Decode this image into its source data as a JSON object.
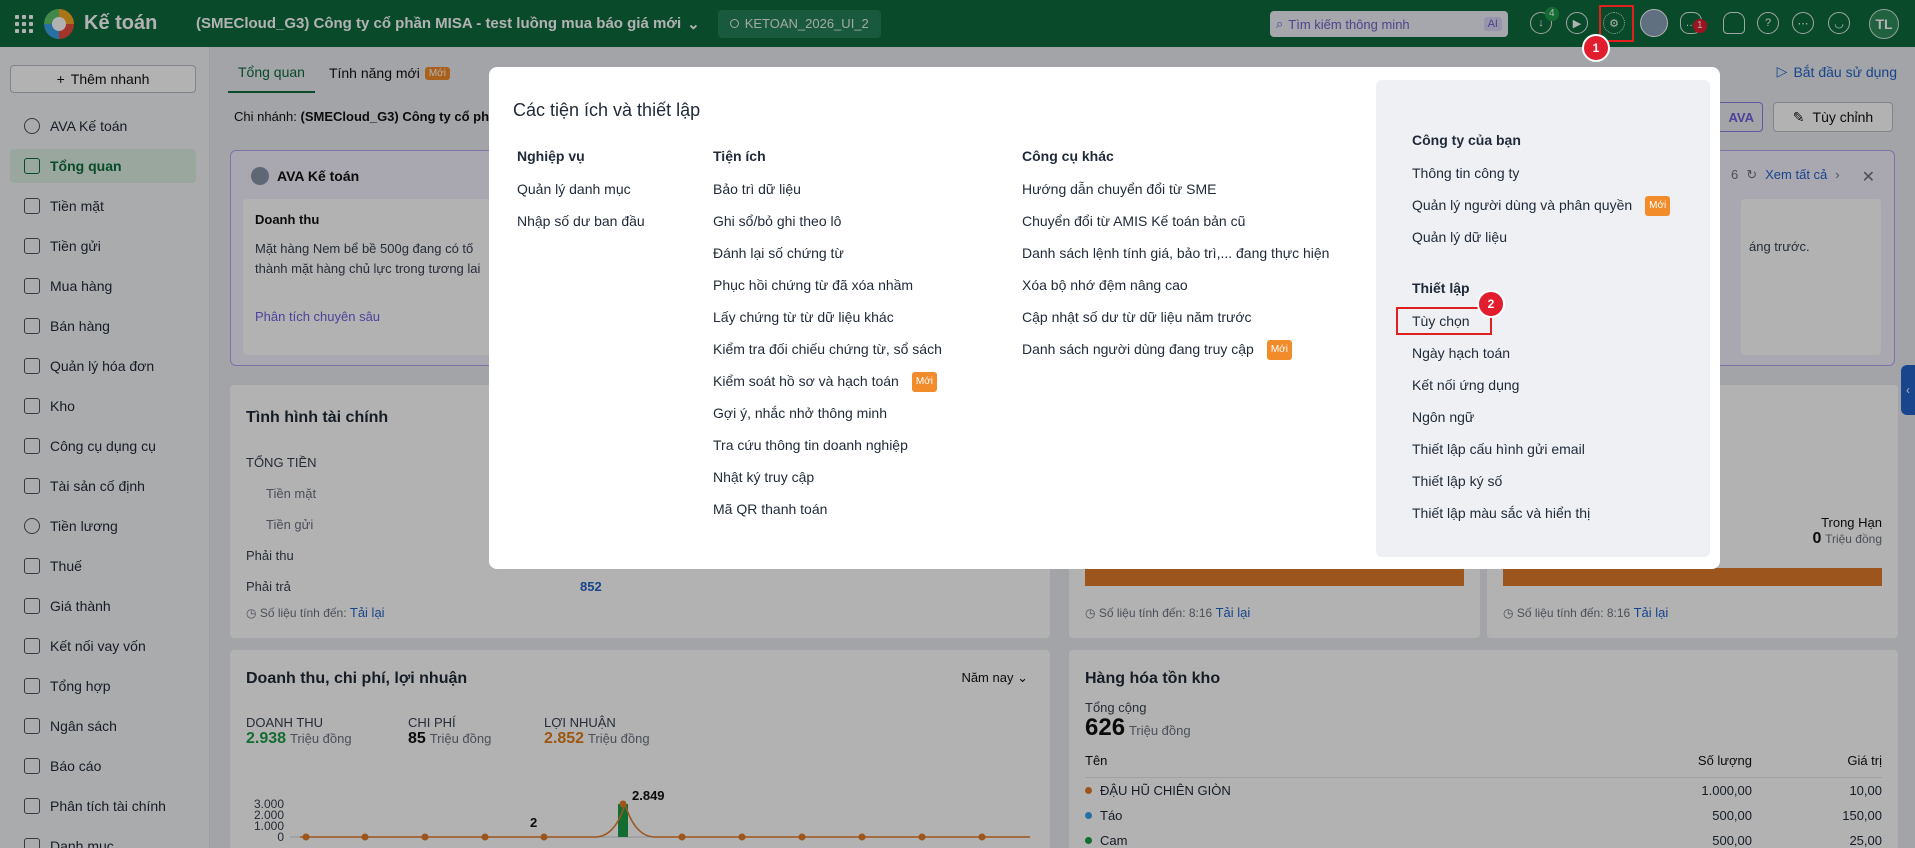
{
  "topbar": {
    "app_name": "Kế toán",
    "company": "(SMECloud_G3) Công ty cổ phần MISA - test luồng mua báo giá mới",
    "database": "KETOAN_2026_UI_2",
    "search_placeholder": "Tìm kiếm thông minh",
    "search_ai": "AI",
    "download_badge": "4",
    "chat_badge": "1",
    "user_initials": "TL"
  },
  "annotations": {
    "step1": "1",
    "step2": "2"
  },
  "sidebar": {
    "quick_add": "Thêm nhanh",
    "items": [
      "AVA Kế toán",
      "Tổng quan",
      "Tiền mặt",
      "Tiền gửi",
      "Mua hàng",
      "Bán hàng",
      "Quản lý hóa đơn",
      "Kho",
      "Công cụ dụng cụ",
      "Tài sản cố định",
      "Tiền lương",
      "Thuế",
      "Giá thành",
      "Kết nối vay vốn",
      "Tổng hợp",
      "Ngân sách",
      "Báo cáo",
      "Phân tích tài chính",
      "Danh mục"
    ]
  },
  "main": {
    "tabs": [
      "Tổng quan",
      "Tính năng mới"
    ],
    "new_badge": "Mới",
    "start_link": "Bắt đầu sử dụng",
    "branch_label": "Chi nhánh:",
    "branch_value": "(SMECloud_G3) Công ty cổ phầ",
    "ava_button": "AVA",
    "customize": "Tùy chỉnh",
    "ava_card": {
      "title": "AVA Kế toán",
      "page_num": "6",
      "see_all": "Xem tất cả",
      "item_title": "Doanh thu",
      "item_text": "Mặt hàng Nem bể bề 500g đang có tố thành mặt hàng chủ lực trong tương lai",
      "item_link": "Phân tích chuyên sâu",
      "right_text": "áng trước."
    },
    "finance": {
      "title": "Tình hình tài chính",
      "total": "TỔNG TIỀN",
      "cash": "Tiền mặt",
      "deposit": "Tiền gửi",
      "receivable": "Phải thu",
      "payable": "Phải trả",
      "payable_value": "852",
      "updated": "Số liệu tính đến:",
      "reload": "Tải lại"
    },
    "mid_card": {
      "updated": "Số liệu tính đến: 8:16",
      "reload": "Tải lại"
    },
    "right_card": {
      "in_term": "Trong Hạn",
      "in_term_value": "0",
      "unit": "Triệu đồng",
      "updated": "Số liệu tính đến: 8:16",
      "reload": "Tải lại"
    },
    "revenue": {
      "title": "Doanh thu, chi phí, lợi nhuận",
      "period": "Năm nay",
      "rev_label": "DOANH THU",
      "rev_value": "2.938",
      "cost_label": "CHI PHÍ",
      "cost_value": "85",
      "profit_label": "LỢI NHUẬN",
      "profit_value": "2.852",
      "unit": "Triệu đồng",
      "peak_label": "2.849",
      "small_label": "2",
      "yticks": [
        "3.000",
        "2.000",
        "1.000",
        "0"
      ]
    },
    "inventory": {
      "title": "Hàng hóa tồn kho",
      "total_label": "Tổng cộng",
      "total_value": "626",
      "unit": "Triệu đồng",
      "col_name": "Tên",
      "col_qty": "Số lượng",
      "col_value": "Giá trị",
      "rows": [
        {
          "name": "ĐẬU HŨ CHIÊN GIÒN",
          "qty": "1.000,00",
          "value": "10,00",
          "color": "#e07b2a"
        },
        {
          "name": "Táo",
          "qty": "500,00",
          "value": "150,00",
          "color": "#3aa0e8"
        },
        {
          "name": "Cam",
          "qty": "500,00",
          "value": "25,00",
          "color": "#1c9c4a"
        }
      ]
    }
  },
  "modal": {
    "title": "Các tiện ích và thiết lập",
    "badge": "Mới",
    "col1": {
      "header": "Nghiệp vụ",
      "items": [
        "Quản lý danh mục",
        "Nhập số dư ban đầu"
      ]
    },
    "col2": {
      "header": "Tiện ích",
      "items": [
        "Bảo trì dữ liệu",
        "Ghi sổ/bỏ ghi theo lô",
        "Đánh lại số chứng từ",
        "Phục hồi chứng từ đã xóa nhầm",
        "Lấy chứng từ từ dữ liệu khác",
        "Kiểm tra đối chiếu chứng từ, sổ sách",
        "Kiểm soát hồ sơ và hạch toán",
        "Gợi ý, nhắc nhở thông minh",
        "Tra cứu thông tin doanh nghiệp",
        "Nhật ký truy cập",
        "Mã QR thanh toán"
      ]
    },
    "col3": {
      "header": "Công cụ khác",
      "items": [
        "Hướng dẫn chuyển đổi từ SME",
        "Chuyển đổi từ AMIS Kế toán bản cũ",
        "Danh sách lệnh tính giá, bảo trì,... đang thực hiện",
        "Xóa bộ nhớ đệm nâng cao",
        "Cập nhật số dư từ dữ liệu năm trước",
        "Danh sách người dùng đang truy cập"
      ]
    },
    "company": {
      "header": "Công ty của bạn",
      "items": [
        "Thông tin công ty",
        "Quản lý người dùng và phân quyền",
        "Quản lý dữ liệu"
      ]
    },
    "settings": {
      "header": "Thiết lập",
      "items": [
        "Tùy chọn",
        "Ngày hạch toán",
        "Kết nối ứng dụng",
        "Ngôn ngữ",
        "Thiết lập cấu hình gửi email",
        "Thiết lập ký số",
        "Thiết lập màu sắc và hiển thị"
      ]
    }
  },
  "colors": {
    "brand": "#0e6b3e",
    "accent_orange": "#f28b2a",
    "alert_red": "#e11d2e",
    "link_blue": "#2563c9"
  }
}
